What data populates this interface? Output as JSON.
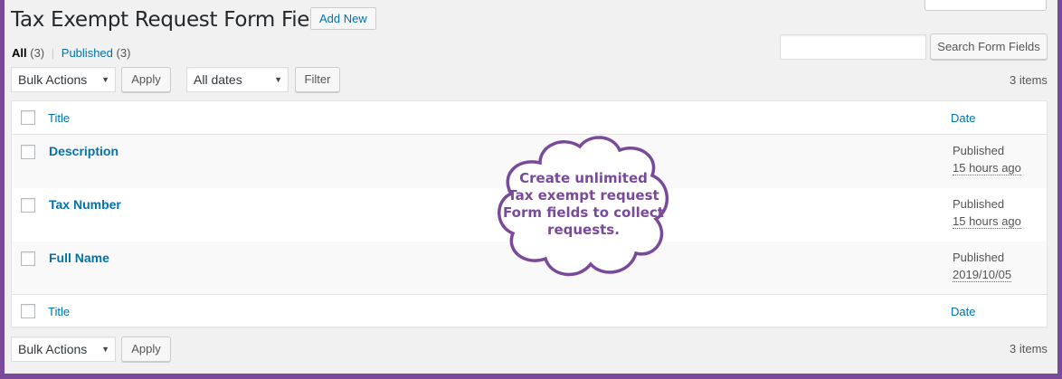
{
  "page": {
    "title": "Tax Exempt Request Form Fields",
    "add_new_label": "Add New"
  },
  "views": {
    "all_label": "All",
    "all_count": "(3)",
    "separator": "|",
    "published_label": "Published",
    "published_count": "(3)"
  },
  "search": {
    "value": "",
    "button_label": "Search Form Fields"
  },
  "top_nav": {
    "bulk_actions_selected": "Bulk Actions",
    "apply_label": "Apply",
    "dates_selected": "All dates",
    "filter_label": "Filter",
    "items_count": "3 items"
  },
  "table": {
    "columns": {
      "title": "Title",
      "date": "Date"
    },
    "rows": [
      {
        "title": "Description",
        "status": "Published",
        "date": "15 hours ago"
      },
      {
        "title": "Tax Number",
        "status": "Published",
        "date": "15 hours ago"
      },
      {
        "title": "Full Name",
        "status": "Published",
        "date": "2019/10/05"
      }
    ]
  },
  "bottom_nav": {
    "bulk_actions_selected": "Bulk Actions",
    "apply_label": "Apply",
    "items_count": "3 items"
  },
  "callout": {
    "lines": [
      "Create unlimited",
      "Tax exempt request",
      "Form fields to collect",
      "requests."
    ]
  },
  "colors": {
    "frame_border": "#7a4a9a",
    "link": "#0073aa",
    "callout": "#7a4a9a"
  },
  "icons": {
    "dropdown": "chevron-down-icon",
    "callout": "cloud-icon"
  }
}
